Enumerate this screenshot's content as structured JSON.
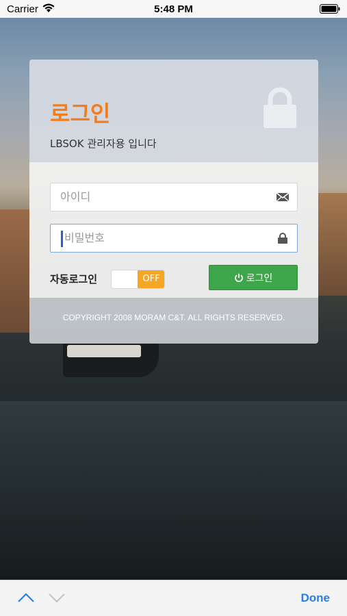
{
  "status_bar": {
    "carrier": "Carrier",
    "time": "5:48 PM"
  },
  "login": {
    "title": "로그인",
    "subtitle": "LBSOK 관리자용 입니다",
    "id_placeholder": "아이디",
    "password_placeholder": "비밀번호",
    "auto_login_label": "자동로그인",
    "toggle_state": "OFF",
    "login_button": "로그인",
    "copyright": "COPYRIGHT 2008 MORAM C&T. ALL RIGHTS RESERVED."
  },
  "accessory_bar": {
    "done_label": "Done"
  },
  "colors": {
    "title": "#f07e1e",
    "toggle_off": "#f5a623",
    "login_button": "#3ea64a",
    "done": "#2a7fe3"
  },
  "icons": [
    "wifi-icon",
    "battery-icon",
    "lock-icon",
    "mail-icon",
    "power-icon",
    "chevron-up-icon",
    "chevron-down-icon"
  ]
}
